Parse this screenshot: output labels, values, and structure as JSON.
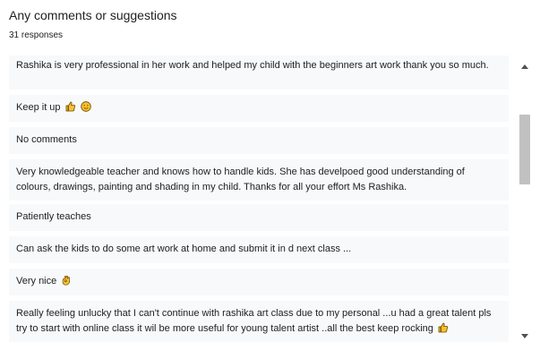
{
  "question": {
    "title": "Any comments or suggestions",
    "response_count": "31 responses"
  },
  "responses": [
    {
      "text": "Rashika is very professional in her work and helped my child with the beginners art work thank you so much."
    },
    {
      "text": "Keep it up",
      "emojis": [
        "thumbs-up-icon",
        "smiley-icon"
      ]
    },
    {
      "text": "No comments"
    },
    {
      "text": "Very knowledgeable teacher and knows how to handle kids. She has develpoed good understanding of colours, drawings, painting and shading in my child. Thanks for all your effort Ms Rashika."
    },
    {
      "text": "Patiently teaches"
    },
    {
      "text": "Can ask the kids to do some art work at home and submit it in d next class ..."
    },
    {
      "text": "Very nice",
      "emojis": [
        "ok-hand-icon"
      ]
    },
    {
      "text": "Really feeling unlucky that I can't continue with rashika art class due to my personal ...u had a great talent pls try to start with online class it wil be more useful for young talent artist ..all the best keep rocking",
      "emojis": [
        "thumbs-up-icon"
      ]
    }
  ],
  "colors": {
    "item_background": "#f8f9fa",
    "scrollbar_thumb": "#c1c1c1",
    "emoji_yellow": "#f9c12e",
    "emoji_outline": "#6b4a00"
  }
}
